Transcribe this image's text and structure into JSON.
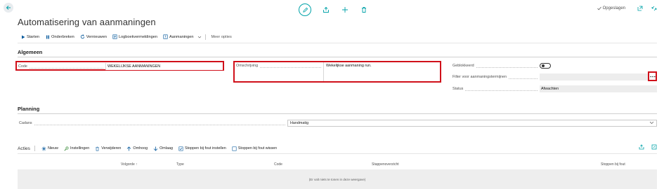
{
  "header": {
    "title": "Automatisering van aanmaningen",
    "saved_label": "Opgeslagen"
  },
  "actions": [
    {
      "label": "Starten",
      "icon": "play-icon"
    },
    {
      "label": "Onderbreken",
      "icon": "pause-icon"
    },
    {
      "label": "Vernieuwen",
      "icon": "refresh-icon"
    },
    {
      "label": "Logboekvermeldingen",
      "icon": "log-icon"
    },
    {
      "label": "Aanmaningen",
      "icon": "reminder-icon"
    }
  ],
  "more_options": "Meer opties",
  "general": {
    "title": "Algemeen",
    "code_label": "Code",
    "code_value": "WEKELIJKSE AANMANINGEN",
    "description_label": "Omschrijving",
    "description_value": "Wekelijkse aanmaning run.",
    "blocked_label": "Geblokkeerd",
    "filter_label": "Filter voor aanmaningstermijnen",
    "filter_value": "",
    "status_label": "Status",
    "status_value": "Afwachten"
  },
  "planning": {
    "title": "Planning",
    "calendar_label": "Cadans",
    "calendar_value": "Handmatig"
  },
  "lines": {
    "title": "Acties",
    "actions": [
      {
        "label": "Nieuw",
        "icon": "new-icon"
      },
      {
        "label": "Instellingen",
        "icon": "settings-icon"
      },
      {
        "label": "Verwijderen",
        "icon": "delete-icon"
      },
      {
        "label": "Omhoog",
        "icon": "arrow-up-icon"
      },
      {
        "label": "Omlaag",
        "icon": "arrow-down-icon"
      },
      {
        "label": "Stoppen bij fout instellen",
        "icon": "checkbox-icon"
      },
      {
        "label": "Stoppen bij fout wissen",
        "icon": "checkbox-empty-icon"
      }
    ],
    "columns": {
      "sequence": "Volgorde ↑",
      "type": "Type",
      "code": "Code",
      "overview": "Stappenoverzicht",
      "stop_on_error": "Stoppen bij fout"
    },
    "empty_message": "(Er valt niets te tonen in deze weergave)"
  },
  "colors": {
    "accent": "#00a2a8",
    "highlight": "#d0101a"
  }
}
